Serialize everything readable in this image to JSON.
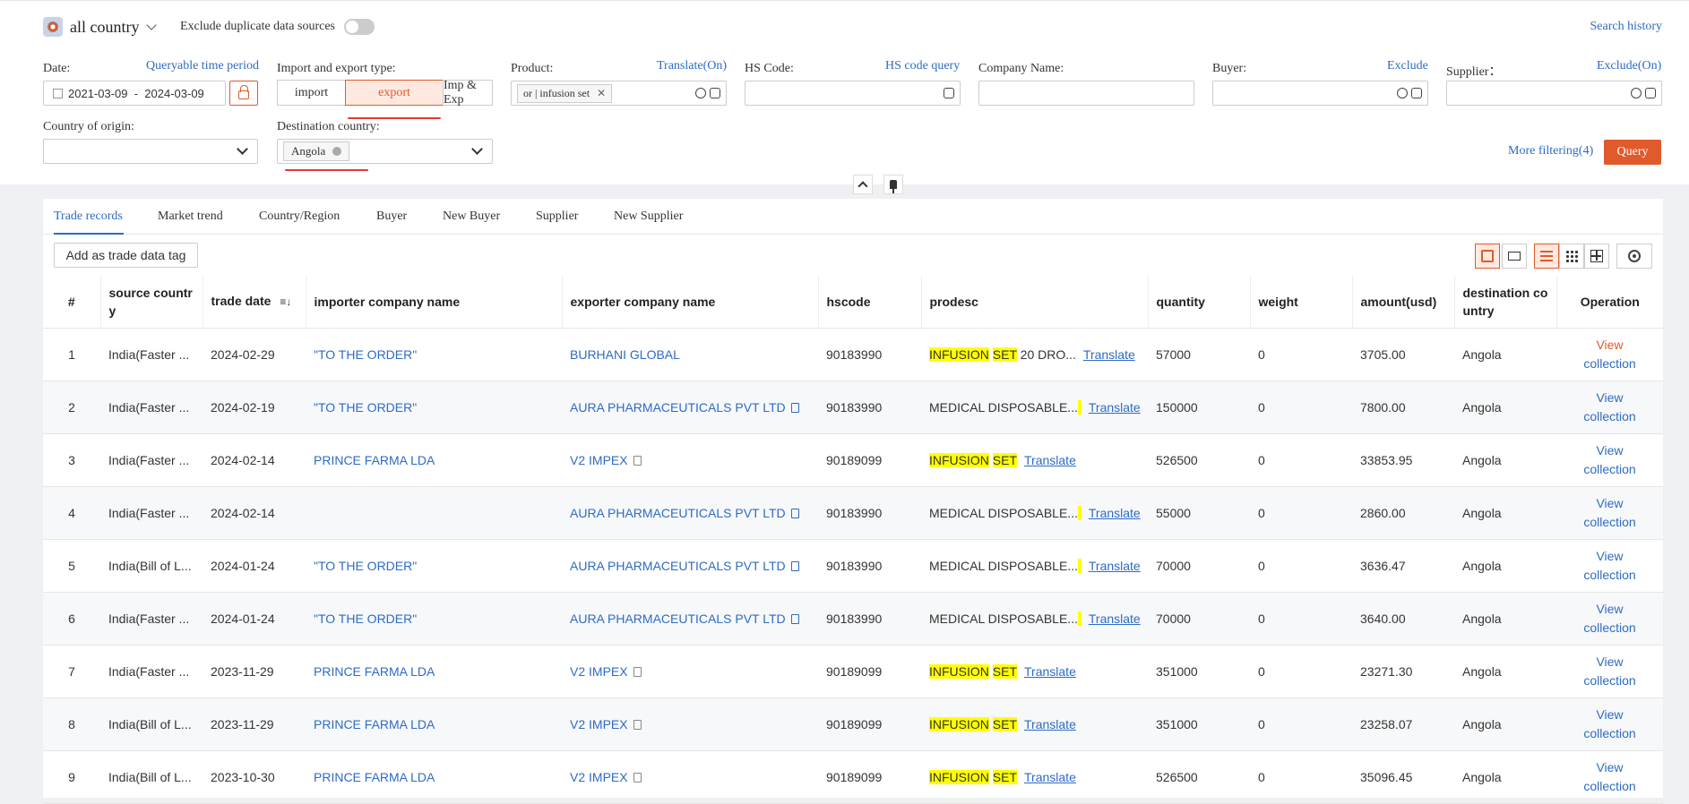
{
  "header": {
    "country_selector": "all country",
    "exclude_duplicate_label": "Exclude duplicate data sources",
    "search_history": "Search history"
  },
  "filters": {
    "date_label": "Date:",
    "queryable_link": "Queryable time period",
    "date_range": "2021-03-09  -  2024-03-09",
    "trade_type_label": "Import and export type:",
    "trade_types": [
      "import",
      "export",
      "Imp & Exp"
    ],
    "product_label": "Product:",
    "translate_link": "Translate(On)",
    "product_tag": "or | infusion set",
    "hs_label": "HS Code:",
    "hs_link": "HS code query",
    "company_label": "Company Name:",
    "buyer_label": "Buyer:",
    "buyer_link": "Exclude",
    "supplier_label": "Supplier：",
    "supplier_link": "Exclude(On)",
    "origin_label": "Country of origin:",
    "destination_label": "Destination country:",
    "destination_tag": "Angola",
    "more_filtering": "More filtering(4)",
    "query_button": "Query"
  },
  "tabs": [
    "Trade records",
    "Market trend",
    "Country/Region",
    "Buyer",
    "New Buyer",
    "Supplier",
    "New Supplier"
  ],
  "toolbar": {
    "add_tag_button": "Add as trade data tag"
  },
  "table": {
    "headers": {
      "num": "#",
      "source_country_1": "source countr",
      "source_country_2": "y",
      "trade_date": "trade date",
      "importer": "importer company name",
      "exporter": "exporter company name",
      "hscode": "hscode",
      "prodesc": "prodesc",
      "quantity": "quantity",
      "weight": "weight",
      "amount": "amount(usd)",
      "dest_1": "destination co",
      "dest_2": "untry",
      "operation": "Operation"
    },
    "translate_label": "Translate",
    "view_label": "View",
    "collection_label": "collection",
    "rows": [
      {
        "n": "1",
        "src": "India(Faster ...",
        "date": "2024-02-29",
        "imp": "\"TO THE ORDER\"",
        "exp": "BURHANI GLOBAL",
        "hs": "90183990",
        "pd1": "INFUSION",
        "pd2": "SET",
        "pd3": " 20 DRO...",
        "qty": "57000",
        "w": "0",
        "amt": "3705.00",
        "dest": "Angola"
      },
      {
        "n": "2",
        "src": "India(Faster ...",
        "date": "2024-02-19",
        "imp": "\"TO THE ORDER\"",
        "exp": "AURA PHARMACEUTICALS PVT LTD",
        "hs": "90183990",
        "pd1": "",
        "pd2": "",
        "pd3": "MEDICAL DISPOSABLE...",
        "qty": "150000",
        "w": "0",
        "amt": "7800.00",
        "dest": "Angola"
      },
      {
        "n": "3",
        "src": "India(Faster ...",
        "date": "2024-02-14",
        "imp": "PRINCE FARMA LDA",
        "exp": "V2 IMPEX",
        "hs": "90189099",
        "pd1": "INFUSION",
        "pd2": "SET",
        "pd3": "",
        "qty": "526500",
        "w": "0",
        "amt": "33853.95",
        "dest": "Angola"
      },
      {
        "n": "4",
        "src": "India(Faster ...",
        "date": "2024-02-14",
        "imp": "",
        "exp": "AURA PHARMACEUTICALS PVT LTD",
        "hs": "90183990",
        "pd1": "",
        "pd2": "",
        "pd3": "MEDICAL DISPOSABLE...",
        "qty": "55000",
        "w": "0",
        "amt": "2860.00",
        "dest": "Angola"
      },
      {
        "n": "5",
        "src": "India(Bill of L...",
        "date": "2024-01-24",
        "imp": "\"TO THE ORDER\"",
        "exp": "AURA PHARMACEUTICALS PVT LTD",
        "hs": "90183990",
        "pd1": "",
        "pd2": "",
        "pd3": "MEDICAL DISPOSABLE...",
        "qty": "70000",
        "w": "0",
        "amt": "3636.47",
        "dest": "Angola"
      },
      {
        "n": "6",
        "src": "India(Faster ...",
        "date": "2024-01-24",
        "imp": "\"TO THE ORDER\"",
        "exp": "AURA PHARMACEUTICALS PVT LTD",
        "hs": "90183990",
        "pd1": "",
        "pd2": "",
        "pd3": "MEDICAL DISPOSABLE...",
        "qty": "70000",
        "w": "0",
        "amt": "3640.00",
        "dest": "Angola"
      },
      {
        "n": "7",
        "src": "India(Faster ...",
        "date": "2023-11-29",
        "imp": "PRINCE FARMA LDA",
        "exp": "V2 IMPEX",
        "hs": "90189099",
        "pd1": "INFUSION",
        "pd2": "SET",
        "pd3": "",
        "qty": "351000",
        "w": "0",
        "amt": "23271.30",
        "dest": "Angola"
      },
      {
        "n": "8",
        "src": "India(Bill of L...",
        "date": "2023-11-29",
        "imp": "PRINCE FARMA LDA",
        "exp": "V2 IMPEX",
        "hs": "90189099",
        "pd1": "INFUSION",
        "pd2": "SET",
        "pd3": "",
        "qty": "351000",
        "w": "0",
        "amt": "23258.07",
        "dest": "Angola"
      },
      {
        "n": "9",
        "src": "India(Bill of L...",
        "date": "2023-10-30",
        "imp": "PRINCE FARMA LDA",
        "exp": "V2 IMPEX",
        "hs": "90189099",
        "pd1": "INFUSION",
        "pd2": "SET",
        "pd3": "",
        "qty": "526500",
        "w": "0",
        "amt": "35096.45",
        "dest": "Angola"
      }
    ]
  },
  "colors": {
    "accent": "#e05a2b",
    "link": "#2d6bc4",
    "highlight": "#ffff00"
  }
}
